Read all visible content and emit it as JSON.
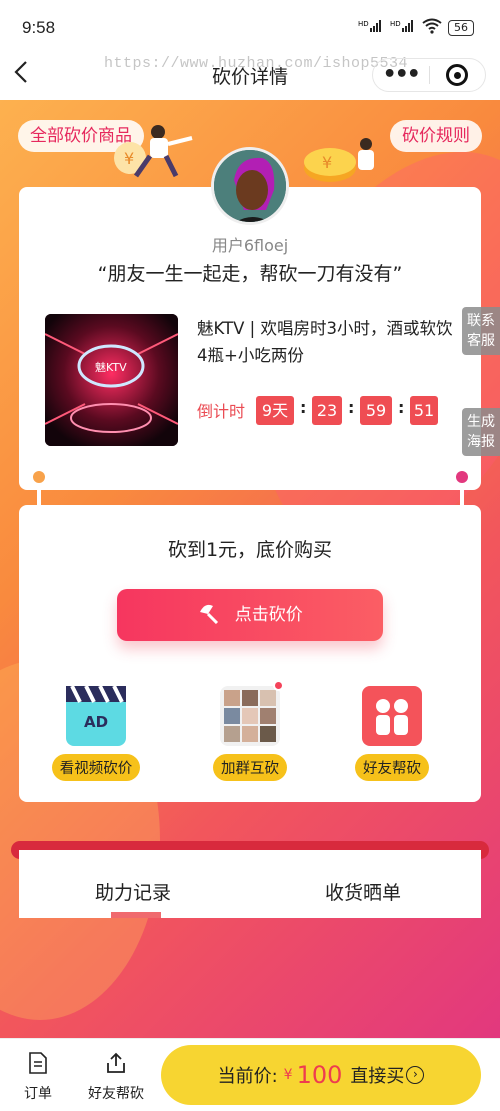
{
  "status_bar": {
    "time": "9:58",
    "network1": "HD",
    "network2": "HD",
    "battery": "56"
  },
  "nav": {
    "title": "砍价详情",
    "watermark": "https://www.huzhan.com/ishop5534"
  },
  "header": {
    "all_products": "全部砍价商品",
    "rules": "砍价规则"
  },
  "share_card": {
    "username": "用户6floej",
    "slogan": "“朋友一生一起走，帮砍一刀有没有”",
    "product": {
      "title": "魅KTV | 欢唱房时3小时，酒或软饮4瓶+小吃两份",
      "image_text": "魅KTV"
    },
    "countdown": {
      "label": "倒计时",
      "days": "9天",
      "hours": "23",
      "minutes": "59",
      "seconds": "51"
    }
  },
  "side_tabs": {
    "contact": "联系客服",
    "poster": "生成海报"
  },
  "deal_card": {
    "headline": "砍到1元，底价购买",
    "cut_button": "点击砍价",
    "actions": [
      {
        "label": "看视频砍价",
        "icon": "video-ad-icon",
        "icon_text": "AD"
      },
      {
        "label": "加群互砍",
        "icon": "group-photos-icon"
      },
      {
        "label": "好友帮砍",
        "icon": "friends-help-icon"
      }
    ]
  },
  "tabs": [
    {
      "label": "助力记录"
    },
    {
      "label": "收货晒单"
    }
  ],
  "bottom_bar": {
    "orders": "订单",
    "share": "好友帮砍",
    "buy": {
      "prefix": "当前价:",
      "currency": "¥",
      "price": "100",
      "action": "直接买"
    }
  },
  "colors": {
    "accent_red": "#ef4d53",
    "buy_yellow": "#f7d531",
    "pink": "#e6285d"
  }
}
